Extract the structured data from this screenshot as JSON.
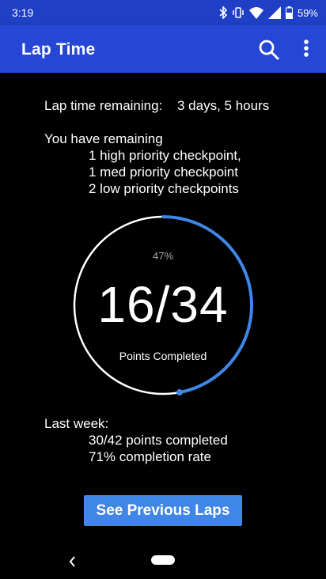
{
  "status_bar": {
    "time": "3:19",
    "battery": "59%"
  },
  "app_bar": {
    "title": "Lap Time"
  },
  "lap": {
    "remaining_label": "Lap time remaining:",
    "remaining_value": "3 days, 5 hours",
    "you_have": "You have remaining",
    "checkpoints": [
      "1 high priority checkpoint,",
      "1 med priority checkpoint",
      "2 low priority checkpoints"
    ]
  },
  "progress": {
    "percent_text": "47%",
    "fraction": 0.47,
    "score": "16/34",
    "caption": "Points Completed"
  },
  "last_week": {
    "label": "Last week:",
    "points": "30/42 points completed",
    "rate": "71% completion rate"
  },
  "button": {
    "label": "See Previous Laps"
  },
  "colors": {
    "status_bar": "#1f3fc4",
    "app_bar": "#2647d6",
    "accent": "#3f86e6"
  }
}
